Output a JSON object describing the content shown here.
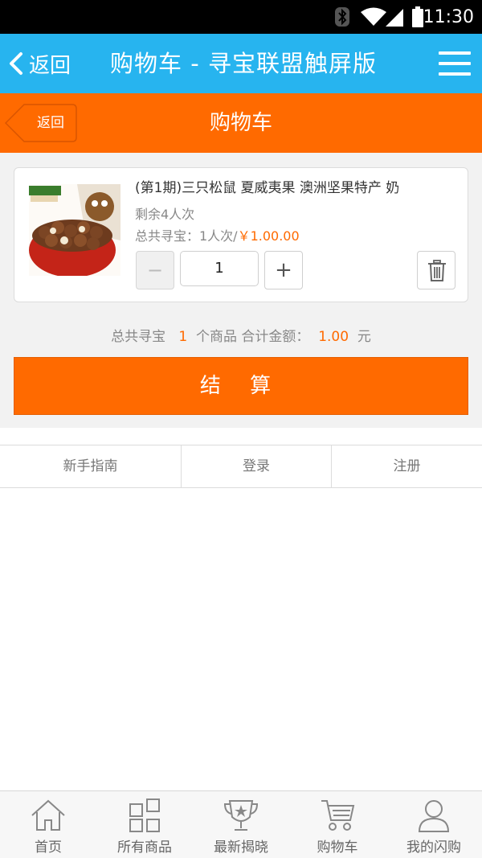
{
  "status_bar": {
    "time": "11:30",
    "icons": [
      "bluetooth-icon",
      "wifi-icon",
      "signal-icon",
      "battery-icon"
    ]
  },
  "app_header": {
    "back_label": "返回",
    "title": "购物车 - 寻宝联盟触屏版",
    "menu_icon": "hamburger-menu-icon",
    "background": "#27b4ef"
  },
  "page_header": {
    "back_label": "返回",
    "title": "购物车",
    "background": "#ff6a00"
  },
  "cart": {
    "items": [
      {
        "title": "(第1期)三只松鼠 夏威夷果 澳洲坚果特产 奶",
        "remaining": "剩余4人次",
        "total_prefix": "总共寻宝：1人次/",
        "price": "￥1.00.00",
        "quantity": "1",
        "minus_label": "−",
        "plus_label": "+",
        "delete_icon": "trash-icon"
      }
    ],
    "summary": {
      "prefix": "总共寻宝",
      "count": "1",
      "middle": "个商品 合计金额：",
      "amount": "1.00",
      "suffix": "元"
    },
    "checkout_label": "结 算"
  },
  "footer_links": [
    "新手指南",
    "登录",
    "注册"
  ],
  "bottom_nav": [
    {
      "label": "首页",
      "icon": "home-icon"
    },
    {
      "label": "所有商品",
      "icon": "grid-icon"
    },
    {
      "label": "最新揭晓",
      "icon": "trophy-icon"
    },
    {
      "label": "购物车",
      "icon": "cart-icon"
    },
    {
      "label": "我的闪购",
      "icon": "user-icon"
    }
  ],
  "colors": {
    "accent_orange": "#ff6a00",
    "header_blue": "#27b4ef",
    "content_gray": "#f2f2f2"
  }
}
